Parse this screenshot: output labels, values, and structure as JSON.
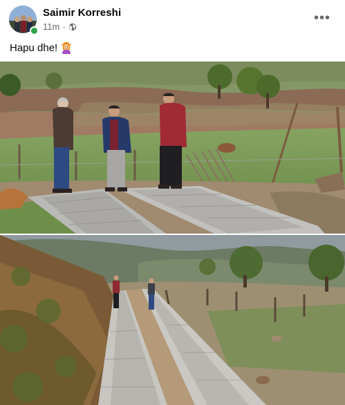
{
  "post": {
    "author": "Saimir Korreshi",
    "time": "11m",
    "separator": "·",
    "privacy_icon": "globe-icon",
    "more_icon": "more-options-icon",
    "more_label": "•••",
    "text": "Hapu dhe!",
    "text_emoji_icon": "woman-gesturing-ok-emoji"
  },
  "colors": {
    "online": "#31a24c",
    "secondary_text": "#65676b",
    "primary_text": "#050505"
  }
}
